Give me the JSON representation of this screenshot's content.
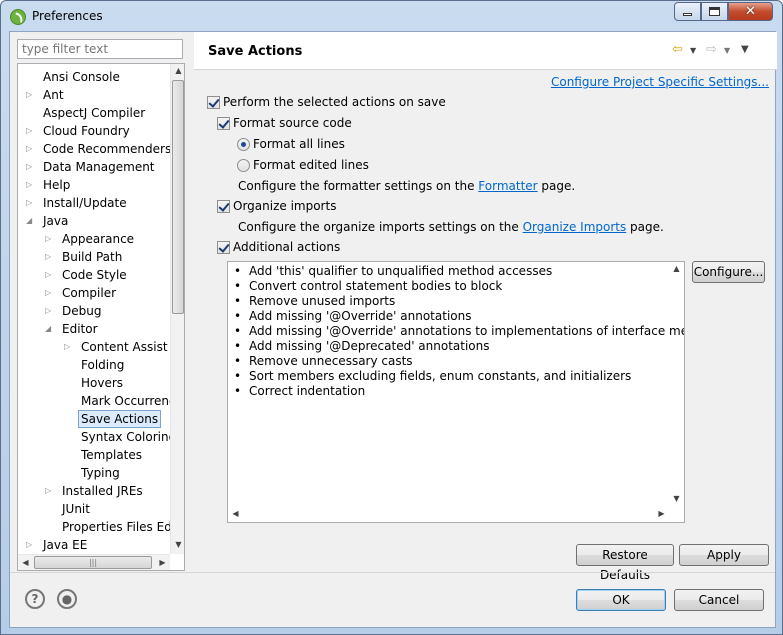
{
  "window": {
    "title": "Preferences"
  },
  "filter": {
    "placeholder": "type filter text"
  },
  "tree": [
    {
      "label": "Ansi Console",
      "level": 0,
      "expander": "none"
    },
    {
      "label": "Ant",
      "level": 0,
      "expander": "collapsed"
    },
    {
      "label": "AspectJ Compiler",
      "level": 0,
      "expander": "none"
    },
    {
      "label": "Cloud Foundry",
      "level": 0,
      "expander": "collapsed"
    },
    {
      "label": "Code Recommenders",
      "level": 0,
      "expander": "collapsed"
    },
    {
      "label": "Data Management",
      "level": 0,
      "expander": "collapsed"
    },
    {
      "label": "Help",
      "level": 0,
      "expander": "collapsed"
    },
    {
      "label": "Install/Update",
      "level": 0,
      "expander": "collapsed"
    },
    {
      "label": "Java",
      "level": 0,
      "expander": "expanded"
    },
    {
      "label": "Appearance",
      "level": 1,
      "expander": "collapsed"
    },
    {
      "label": "Build Path",
      "level": 1,
      "expander": "collapsed"
    },
    {
      "label": "Code Style",
      "level": 1,
      "expander": "collapsed"
    },
    {
      "label": "Compiler",
      "level": 1,
      "expander": "collapsed"
    },
    {
      "label": "Debug",
      "level": 1,
      "expander": "collapsed"
    },
    {
      "label": "Editor",
      "level": 1,
      "expander": "expanded"
    },
    {
      "label": "Content Assist",
      "level": 2,
      "expander": "collapsed"
    },
    {
      "label": "Folding",
      "level": 2,
      "expander": "none"
    },
    {
      "label": "Hovers",
      "level": 2,
      "expander": "none"
    },
    {
      "label": "Mark Occurrences",
      "level": 2,
      "expander": "none"
    },
    {
      "label": "Save Actions",
      "level": 2,
      "expander": "none",
      "selected": true
    },
    {
      "label": "Syntax Coloring",
      "level": 2,
      "expander": "none"
    },
    {
      "label": "Templates",
      "level": 2,
      "expander": "none"
    },
    {
      "label": "Typing",
      "level": 2,
      "expander": "none"
    },
    {
      "label": "Installed JREs",
      "level": 1,
      "expander": "collapsed"
    },
    {
      "label": "JUnit",
      "level": 1,
      "expander": "none"
    },
    {
      "label": "Properties Files Editor",
      "level": 1,
      "expander": "none"
    },
    {
      "label": "Java EE",
      "level": 0,
      "expander": "collapsed"
    }
  ],
  "page": {
    "title": "Save Actions",
    "configure_link": "Configure Project Specific Settings...",
    "perform_label": "Perform the selected actions on save",
    "format_label": "Format source code",
    "format_all_label": "Format all lines",
    "format_edited_label": "Format edited lines",
    "formatter_text_before": "Configure the formatter settings on the ",
    "formatter_link": "Formatter",
    "formatter_text_after": " page.",
    "organize_label": "Organize imports",
    "organize_text_before": "Configure the organize imports settings on the ",
    "organize_link": "Organize Imports",
    "organize_text_after": " page.",
    "additional_label": "Additional actions",
    "actions": [
      "Add 'this' qualifier to unqualified method accesses",
      "Convert control statement bodies to block",
      "Remove unused imports",
      "Add missing '@Override' annotations",
      "Add missing '@Override' annotations to implementations of interface methods",
      "Add missing '@Deprecated' annotations",
      "Remove unnecessary casts",
      "Sort members excluding fields, enum constants, and initializers",
      "Correct indentation"
    ]
  },
  "buttons": {
    "configure": "Configure...",
    "restore_defaults": "Restore Defaults",
    "apply": "Apply",
    "ok": "OK",
    "cancel": "Cancel"
  },
  "colors": {
    "link": "#0066cc",
    "selection": "#dcebfc"
  }
}
